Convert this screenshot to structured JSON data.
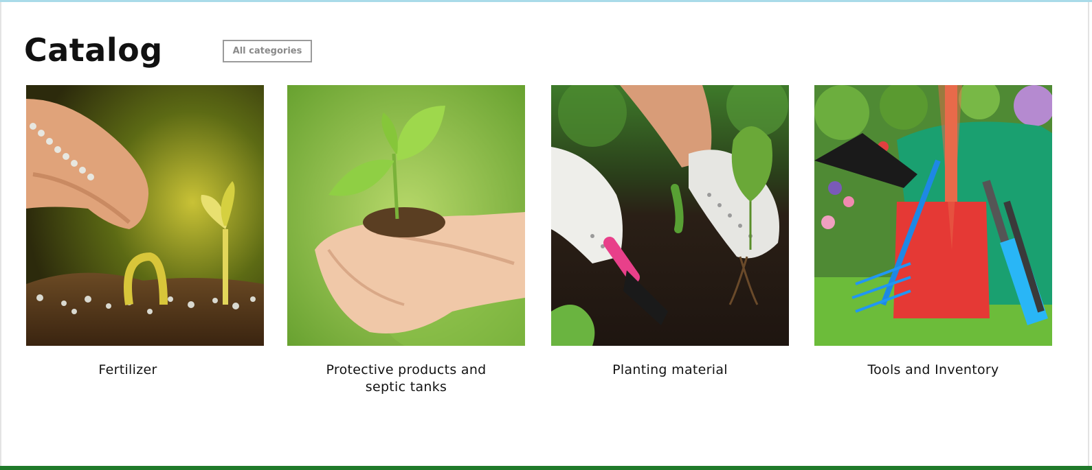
{
  "page": {
    "title": "Catalog"
  },
  "header": {
    "all_categories_label": "All categories"
  },
  "categories": [
    {
      "label": "Fertilizer"
    },
    {
      "label": "Protective products and septic tanks"
    },
    {
      "label": "Planting material"
    },
    {
      "label": "Tools and Inventory"
    }
  ],
  "colors": {
    "top_bar": "#a9dbe9",
    "bottom_bar": "#1f7a2a",
    "button_border": "#9a9a9a"
  }
}
